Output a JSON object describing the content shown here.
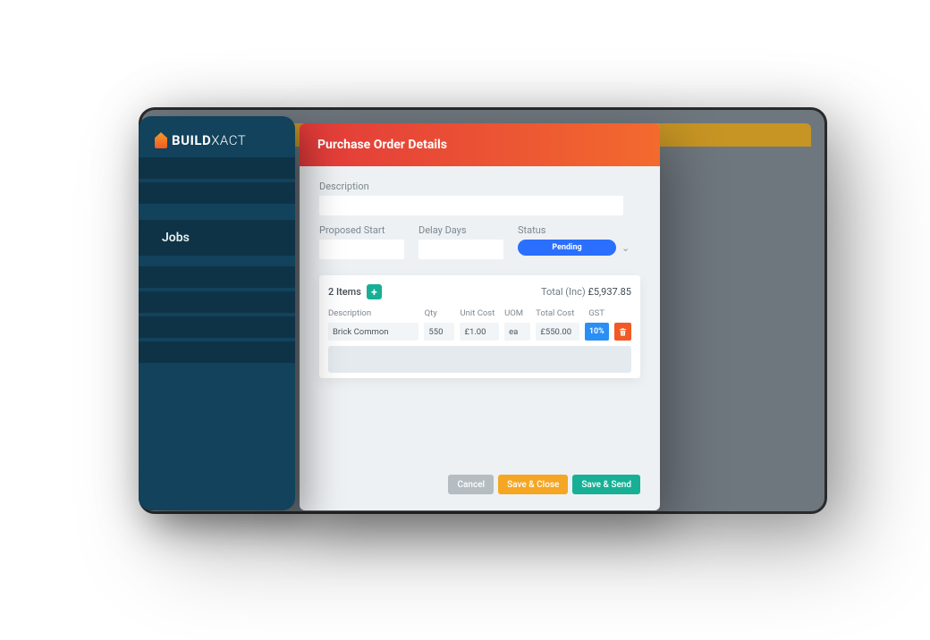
{
  "brand": {
    "part1": "BUILD",
    "part2": "XACT"
  },
  "sidebar": {
    "active_label": "Jobs"
  },
  "modal": {
    "title": "Purchase Order Details",
    "labels": {
      "description": "Description",
      "proposed_start": "Proposed Start",
      "delay_days": "Delay Days",
      "status": "Status"
    },
    "status_value": "Pending",
    "items_count_label": "2 Items",
    "total_label": "Total (Inc)",
    "total_value": "£5,937.85",
    "columns": {
      "description": "Description",
      "qty": "Qty",
      "unit_cost": "Unit Cost",
      "uom": "UOM",
      "total_cost": "Total Cost",
      "gst": "GST"
    },
    "rows": [
      {
        "description": "Brick Common",
        "qty": "550",
        "unit_cost": "£1.00",
        "uom": "ea",
        "total_cost": "£550.00",
        "gst": "10%"
      }
    ],
    "buttons": {
      "cancel": "Cancel",
      "save_close": "Save & Close",
      "save_send": "Save & Send"
    }
  }
}
